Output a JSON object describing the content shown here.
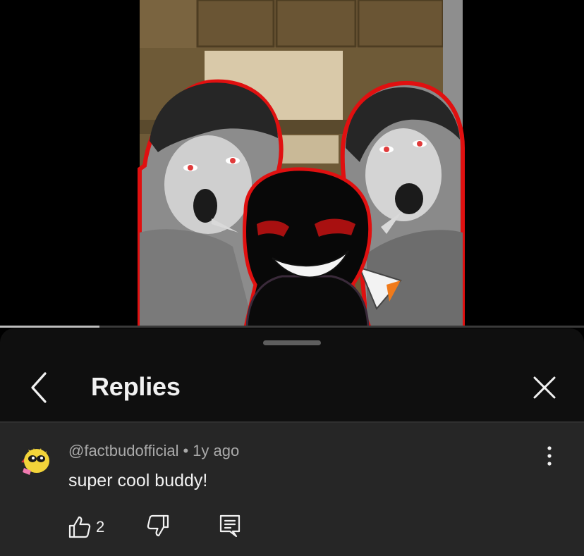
{
  "video": {
    "progress_fraction": 0.17
  },
  "sheet": {
    "title": "Replies",
    "back_icon": "chevron-left-icon",
    "close_icon": "close-icon"
  },
  "comment": {
    "author": "@factbudofficial",
    "separator": "•",
    "time": "1y ago",
    "text": "super cool buddy!",
    "like_count": "2",
    "icons": {
      "like": "thumbs-up-icon",
      "dislike": "thumbs-down-icon",
      "reply": "reply-icon",
      "more": "more-vertical-icon"
    }
  },
  "colors": {
    "sheet_background": "#0f0f0f",
    "comment_background": "#262626",
    "primary_text": "#f1f1f1",
    "secondary_text": "#aaaaaa",
    "progress_fill": "#bdbdbd"
  }
}
